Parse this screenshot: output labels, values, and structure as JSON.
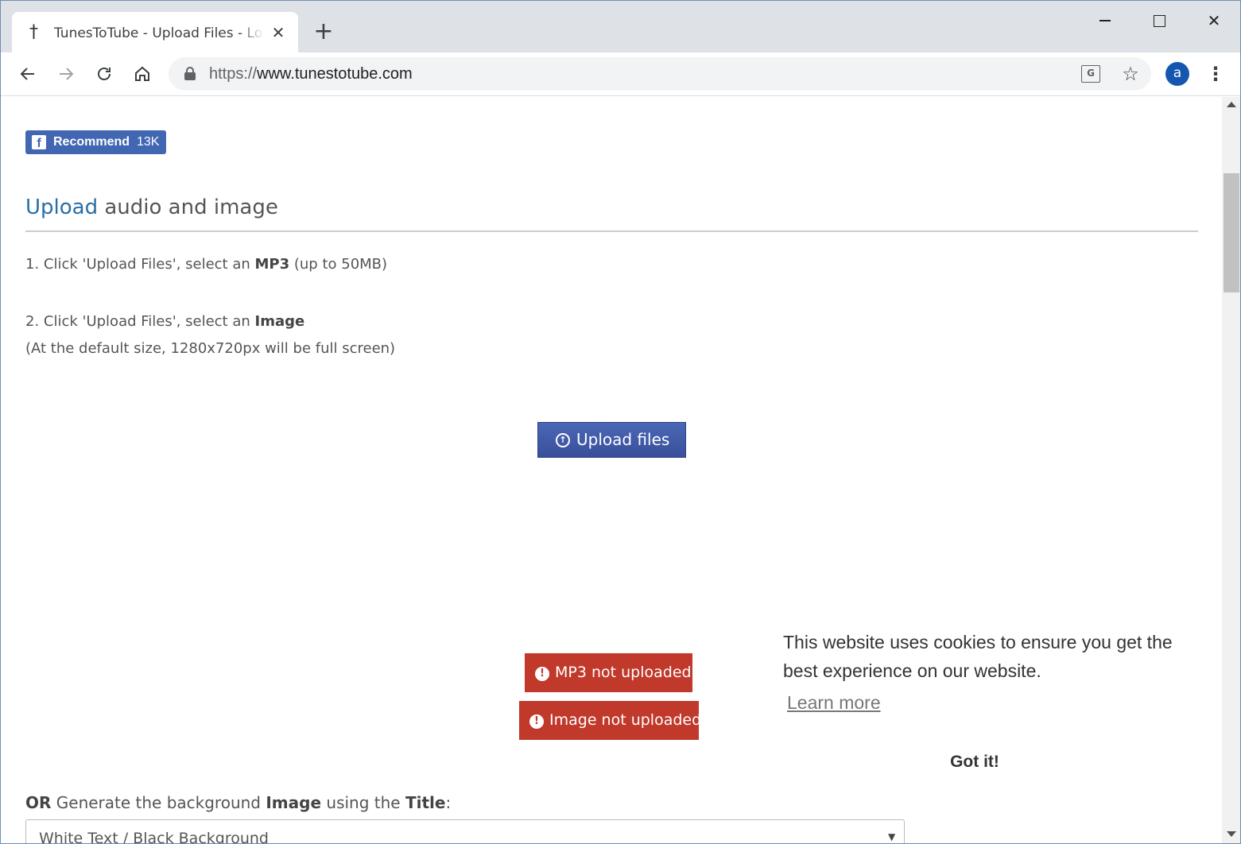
{
  "browser": {
    "tab_title": "TunesToTube - Upload Files - Log",
    "tab_close": "✕",
    "new_tab": "+",
    "url_scheme": "https://",
    "url_host": "www.tunestotube.com",
    "avatar_letter": "a",
    "translate_label": "G",
    "window_close": "✕"
  },
  "facebook": {
    "label": "Recommend",
    "count": "13K",
    "logo": "f"
  },
  "section": {
    "title_accent": "Upload",
    "title_rest": " audio and image"
  },
  "steps": {
    "step1_prefix": "1. Click 'Upload Files', select an ",
    "step1_bold": "MP3",
    "step1_suffix": " (up to 50MB)",
    "step2_prefix": "2. Click 'Upload Files', select an ",
    "step2_bold": "Image",
    "step2_note": "(At the default size, 1280x720px will be full screen)"
  },
  "upload": {
    "button_label": "Upload files"
  },
  "alerts": {
    "mp3": "MP3 not uploaded",
    "image": "Image not uploaded",
    "icon": "!"
  },
  "generate": {
    "or_bold": "OR",
    "text1": " Generate the background ",
    "image_bold": "Image",
    "text2": " using the ",
    "title_bold": "Title",
    "colon": ":",
    "select_value": "White Text / Black Background"
  },
  "cookie": {
    "message": "This website uses cookies to ensure you get the best experience on our website.",
    "learn_more": "Learn more",
    "button": "Got it!"
  },
  "colors": {
    "accent": "#2a6ea6",
    "upload_button": "#3f57a8",
    "alert": "#c0392b",
    "facebook": "#4267b2"
  }
}
